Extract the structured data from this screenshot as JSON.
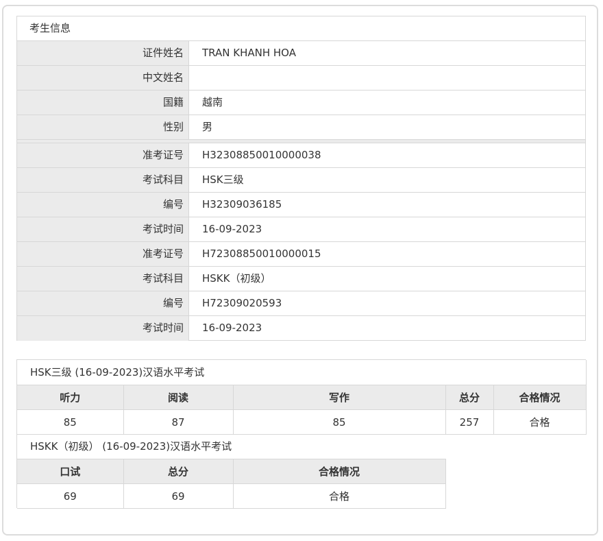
{
  "candidate": {
    "title": "考生信息",
    "basic": [
      {
        "label": "证件姓名",
        "value": "TRAN KHANH HOA"
      },
      {
        "label": "中文姓名",
        "value": ""
      },
      {
        "label": "国籍",
        "value": "越南"
      },
      {
        "label": "性别",
        "value": "男"
      }
    ],
    "exams": [
      {
        "label": "准考证号",
        "value": "H32308850010000038"
      },
      {
        "label": "考试科目",
        "value": "HSK三级"
      },
      {
        "label": "编号",
        "value": "H32309036185"
      },
      {
        "label": "考试时间",
        "value": "16-09-2023"
      },
      {
        "label": "准考证号",
        "value": "H72308850010000015"
      },
      {
        "label": "考试科目",
        "value": "HSKK（初级）"
      },
      {
        "label": "编号",
        "value": "H72309020593"
      },
      {
        "label": "考试时间",
        "value": "16-09-2023"
      }
    ]
  },
  "hsk": {
    "title": "HSK三级 (16-09-2023)汉语水平考试",
    "headers": [
      "听力",
      "阅读",
      "写作",
      "总分",
      "合格情况"
    ],
    "values": [
      "85",
      "87",
      "85",
      "257",
      "合格"
    ]
  },
  "hskk": {
    "title": "HSKK（初级） (16-09-2023)汉语水平考试",
    "headers": [
      "口试",
      "总分",
      "合格情况"
    ],
    "values": [
      "69",
      "69",
      "合格"
    ]
  }
}
